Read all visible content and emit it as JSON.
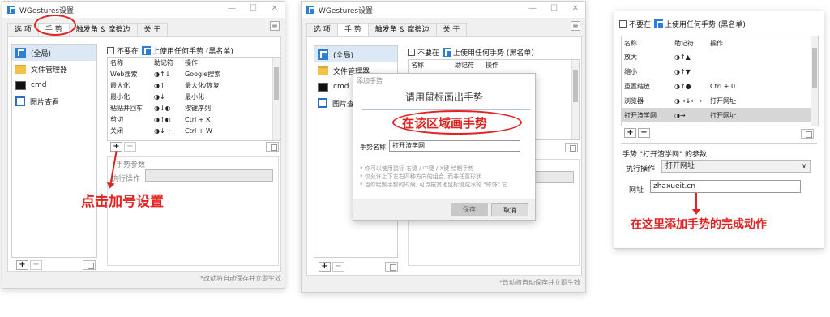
{
  "app": {
    "title": "WGestures设置"
  },
  "tabs": [
    "选 项",
    "手 势",
    "触发角 & 摩擦边",
    "关 于"
  ],
  "apps": [
    {
      "label": "(全局)",
      "icon": "cursor-icon"
    },
    {
      "label": "文件管理器",
      "icon": "folder-icon"
    },
    {
      "label": "cmd",
      "icon": "cmd-icon"
    },
    {
      "label": "图片查看",
      "icon": "image-viewer-icon"
    }
  ],
  "disable_label": "不要在",
  "disable_label2": "上使用任何手势 (黑名单)",
  "columns": [
    "名称",
    "助记符",
    "操作"
  ],
  "gestures1": [
    {
      "name": "Web搜索",
      "mnemonic": "◑↑↓",
      "action": "Google搜索"
    },
    {
      "name": "最大化",
      "mnemonic": "◑↑",
      "action": "最大化/恢复"
    },
    {
      "name": "最小化",
      "mnemonic": "◑↓",
      "action": "最小化"
    },
    {
      "name": "粘贴并回车",
      "mnemonic": "◑↓◐",
      "action": "按键序列"
    },
    {
      "name": "剪切",
      "mnemonic": "◑↑◐",
      "action": "Ctrl + X"
    },
    {
      "name": "关闭",
      "mnemonic": "◑↓→",
      "action": "Ctrl + W"
    }
  ],
  "gestures2": [
    {
      "name": "Web搜索",
      "mnemonic": "◑↑↓",
      "action": "Google搜索"
    }
  ],
  "gestures3": [
    {
      "name": "放大",
      "mnemonic": "◑↑▲",
      "action": ""
    },
    {
      "name": "缩小",
      "mnemonic": "◑↑▼",
      "action": ""
    },
    {
      "name": "重置缩放",
      "mnemonic": "◑↑●",
      "action": "Ctrl + 0"
    },
    {
      "name": "浏览器",
      "mnemonic": "◑→↓←→",
      "action": "打开网址"
    },
    {
      "name": "打开渣学网",
      "mnemonic": "◑→",
      "action": "打开网址"
    }
  ],
  "params_label": "手势参数",
  "exec_label": "执行操作",
  "exec_value": "打开网址",
  "url_label": "网址",
  "url_value": "zhaxueit.cn",
  "params_label3": "手势 \"打开渣学网\" 的参数",
  "footer": "*改动将自动保存并立即生效",
  "dialog": {
    "title": "添加手势",
    "heading": "请用鼠标画出手势",
    "name_label": "手势名称",
    "name_value": "打开渣学网",
    "tip1": "* 你可以使用鼠标 右键 / 中键 / X键 绘制手势",
    "tip2": "* 仅允许上下左右四种方向的组合, 而非任意形状",
    "tip3": "* 当你绘制手势的时候, 可点按其他鼠标键或滚轮 \"修饰\" 它",
    "save": "保存",
    "cancel": "取消"
  },
  "annotations": {
    "a1": "点击加号设置",
    "a2": "在该区域画手势",
    "a3": "在这里添加手势的完成动作"
  },
  "colors": {
    "accent": "#2b7fd4",
    "annotation": "#e42222"
  }
}
